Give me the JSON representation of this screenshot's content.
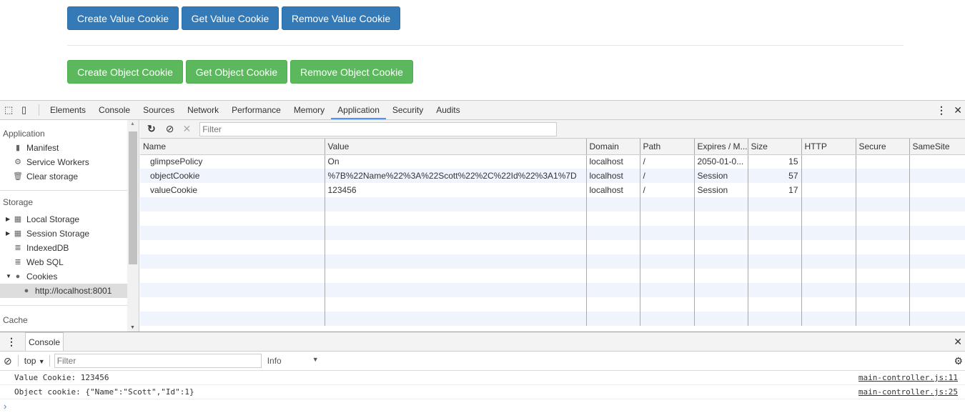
{
  "page": {
    "value_buttons": [
      "Create Value Cookie",
      "Get Value Cookie",
      "Remove Value Cookie"
    ],
    "object_buttons": [
      "Create Object Cookie",
      "Get Object Cookie",
      "Remove Object Cookie"
    ]
  },
  "devtools": {
    "tabs": [
      "Elements",
      "Console",
      "Sources",
      "Network",
      "Performance",
      "Memory",
      "Application",
      "Security",
      "Audits"
    ],
    "active_tab": "Application",
    "sidebar": {
      "application_header": "Application",
      "application_items": [
        "Manifest",
        "Service Workers",
        "Clear storage"
      ],
      "storage_header": "Storage",
      "storage_items": [
        "Local Storage",
        "Session Storage",
        "IndexedDB",
        "Web SQL",
        "Cookies"
      ],
      "cookie_origin": "http://localhost:8001",
      "cache_header": "Cache"
    },
    "filter_placeholder": "Filter",
    "columns": [
      "Name",
      "Value",
      "Domain",
      "Path",
      "Expires / M...",
      "Size",
      "HTTP",
      "Secure",
      "SameSite"
    ],
    "rows": [
      [
        "glimpsePolicy",
        "On",
        "localhost",
        "/",
        "2050-01-0...",
        "15",
        "",
        "",
        ""
      ],
      [
        "objectCookie",
        "%7B%22Name%22%3A%22Scott%22%2C%22Id%22%3A1%7D",
        "localhost",
        "/",
        "Session",
        "57",
        "",
        "",
        ""
      ],
      [
        "valueCookie",
        "123456",
        "localhost",
        "/",
        "Session",
        "17",
        "",
        "",
        ""
      ]
    ],
    "console": {
      "tab": "Console",
      "context": "top",
      "filter_placeholder": "Filter",
      "level": "Info",
      "messages": [
        {
          "text": "Value Cookie: 123456",
          "source": "main-controller.js:11"
        },
        {
          "text": "Object cookie: {\"Name\":\"Scott\",\"Id\":1}",
          "source": "main-controller.js:25"
        }
      ],
      "prompt": "›"
    }
  }
}
